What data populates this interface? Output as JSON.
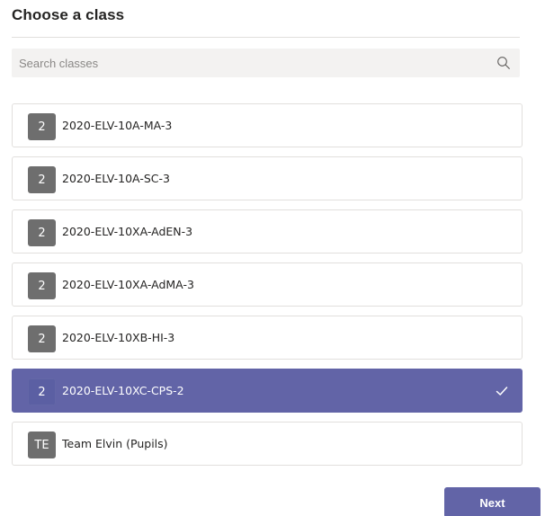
{
  "dialog": {
    "title": "Choose a class"
  },
  "search": {
    "placeholder": "Search classes",
    "value": "",
    "icon": "search-icon"
  },
  "classes": [
    {
      "avatar": "2",
      "name": "2020-ELV-10A-MA-3",
      "selected": false
    },
    {
      "avatar": "2",
      "name": "2020-ELV-10A-SC-3",
      "selected": false
    },
    {
      "avatar": "2",
      "name": "2020-ELV-10XA-AdEN-3",
      "selected": false
    },
    {
      "avatar": "2",
      "name": "2020-ELV-10XA-AdMA-3",
      "selected": false
    },
    {
      "avatar": "2",
      "name": "2020-ELV-10XB-HI-3",
      "selected": false
    },
    {
      "avatar": "2",
      "name": "2020-ELV-10XC-CPS-2",
      "selected": true
    },
    {
      "avatar": "TE",
      "name": "Team Elvin (Pupils)",
      "selected": false
    }
  ],
  "footer": {
    "next_label": "Next"
  },
  "colors": {
    "accent": "#6264a7",
    "avatar_bg": "#6e6e6e",
    "border": "#e1dfdd",
    "search_bg": "#f3f2f1"
  }
}
